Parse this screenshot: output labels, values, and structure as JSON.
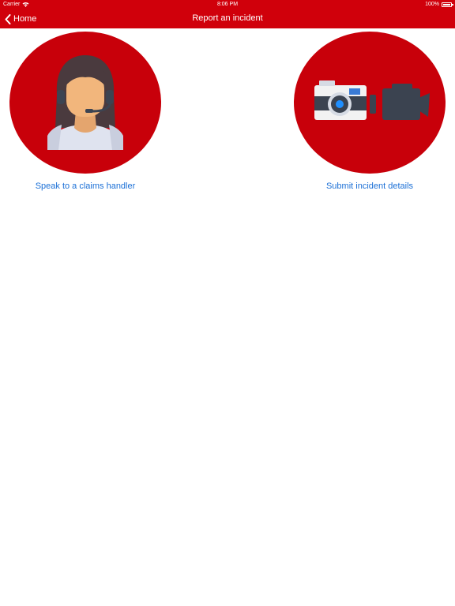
{
  "status_bar": {
    "carrier": "Carrier",
    "time": "8:06 PM",
    "battery": "100%"
  },
  "nav": {
    "back_label": "Home",
    "title": "Report an incident"
  },
  "tiles": [
    {
      "label": "Speak to a claims handler",
      "icon": "call-agent-icon"
    },
    {
      "label": "Submit incident details",
      "icon": "camera-video-icon"
    }
  ],
  "colors": {
    "brand_red": "#d0000b",
    "link_blue": "#1a6fd6"
  }
}
